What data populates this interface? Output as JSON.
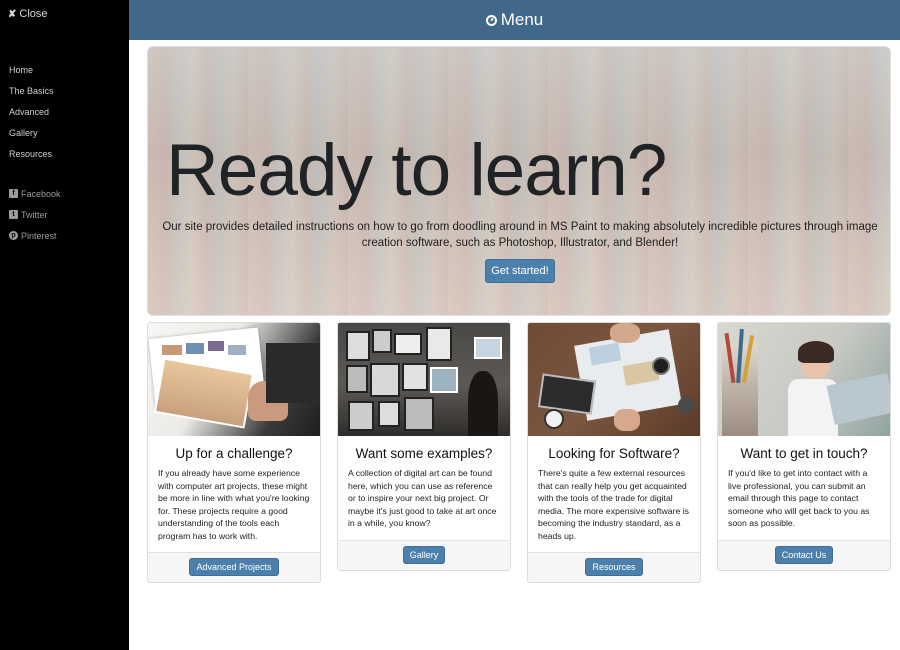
{
  "sidebar": {
    "close_label": "Close",
    "close_icon": "✘",
    "nav": [
      "Home",
      "The Basics",
      "Advanced",
      "Gallery",
      "Resources"
    ],
    "social": [
      {
        "label": "Facebook",
        "icon": "facebook-icon"
      },
      {
        "label": "Twitter",
        "icon": "twitter-icon"
      },
      {
        "label": "Pinterest",
        "icon": "pinterest-icon"
      }
    ]
  },
  "topbar": {
    "menu_label": "Menu",
    "menu_icon": "compass-icon",
    "color": "#41688a"
  },
  "hero": {
    "title": "Ready to learn?",
    "text": "Our site provides detailed instructions on how to go from doodling around in MS Paint to making absolutely incredible pictures through image creation software, such as Photoshop, Illustrator, and Blender!",
    "button": "Get started!"
  },
  "cards": [
    {
      "title": "Up for a challenge?",
      "text": "If you already have some experience with computer art projects, these might be more in line with what you're looking for. These projects require a good understanding of the tools each program has to work with.",
      "button": "Advanced Projects"
    },
    {
      "title": "Want some examples?",
      "text": "A collection of digital art can be found here, which you can use as reference or to inspire your next big project. Or maybe it's just good to take at art once in a while, you know?",
      "button": "Gallery"
    },
    {
      "title": "Looking for Software?",
      "text": "There's quite a few external resources that can really help you get acquainted with the tools of the trade for digital media. The more expensive software is becoming the industry standard, as a heads up.",
      "button": "Resources"
    },
    {
      "title": "Want to get in touch?",
      "text": "If you'd like to get into contact with a live professional, you can submit an email through this page to contact someone who will get back to you as soon as possible.",
      "button": "Contact Us"
    }
  ],
  "accent": "#4c80ac"
}
